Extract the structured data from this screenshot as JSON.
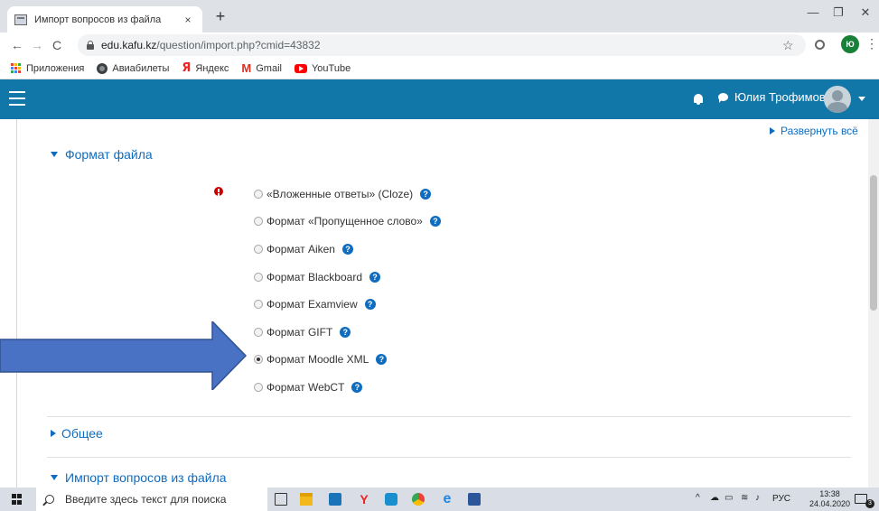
{
  "browser": {
    "tab_title": "Импорт вопросов из файла",
    "tab_close": "×",
    "new_tab": "+",
    "minimize": "—",
    "restore": "❐",
    "close": "✕",
    "back": "←",
    "forward": "→",
    "reload": "C",
    "url_host": "edu.kafu.kz",
    "url_path": "/question/import.php?cmid=43832",
    "star": "☆",
    "profile_initial": "Ю",
    "menu": "⋮"
  },
  "bookmarks": [
    {
      "label": "Приложения",
      "icon": "apps-icon"
    },
    {
      "label": "Авиабилеты",
      "icon": "globe-icon"
    },
    {
      "label": "Яндекс",
      "icon": "yandex-icon",
      "glyph": "Я"
    },
    {
      "label": "Gmail",
      "icon": "gmail-icon",
      "glyph": "M"
    },
    {
      "label": "YouTube",
      "icon": "youtube-icon"
    }
  ],
  "navbar": {
    "user_name": "Юлия Трофимова",
    "color": "#1177a8"
  },
  "page": {
    "expand_all": "Развернуть всё",
    "sections": {
      "file_format": "Формат файла",
      "general": "Общее",
      "import_from_file": "Импорт вопросов из файла"
    },
    "formats": [
      {
        "label": "«Вложенные ответы» (Cloze)",
        "checked": false
      },
      {
        "label": "Формат «Пропущенное слово»",
        "checked": false
      },
      {
        "label": "Формат Aiken",
        "checked": false
      },
      {
        "label": "Формат Blackboard",
        "checked": false
      },
      {
        "label": "Формат Examview",
        "checked": false
      },
      {
        "label": "Формат GIFT",
        "checked": false
      },
      {
        "label": "Формат Moodle XML",
        "checked": true
      },
      {
        "label": "Формат WebCT",
        "checked": false
      }
    ],
    "help_glyph": "?",
    "accent_color": "#0f6cbf",
    "annotation_arrow_color": "#4a72c4"
  },
  "taskbar": {
    "search_placeholder": "Введите здесь текст для поиска",
    "language": "РУС",
    "time": "13:38",
    "date": "24.04.2020",
    "notification_count": "3"
  }
}
